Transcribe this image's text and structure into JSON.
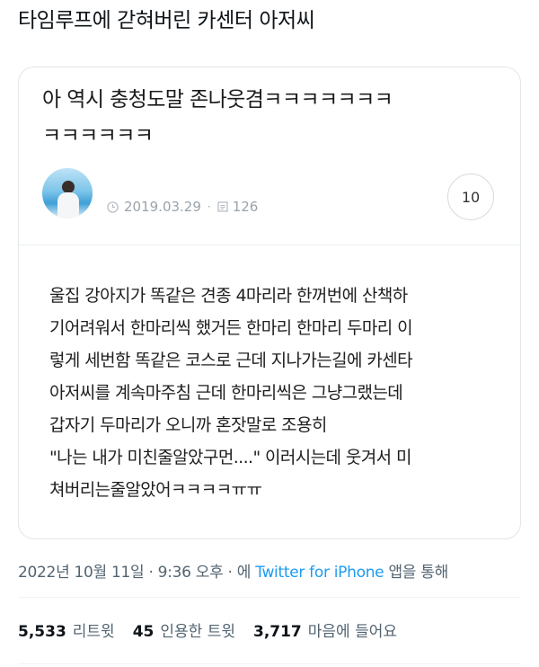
{
  "tweet": {
    "text": "타임루프에 갇혀버린 카센터 아저씨",
    "time": "2022년 10월 11일 · 9:36 오후 · 에 ",
    "source": "Twitter for iPhone",
    "source_suffix": " 앱을 통해"
  },
  "card": {
    "title_lines": [
      "아 역시 충청도말 존나웃겸ㅋㅋㅋㅋㅋㅋㅋ",
      "ㅋㅋㅋㅋㅋㅋ"
    ],
    "date": "2019.03.29",
    "views": "126",
    "comment_count": "10",
    "body_lines": [
      "울집 강아지가 똑같은 견종 4마리라 한꺼번에 산책하",
      "기어려워서 한마리씩 했거든 한마리 한마리 두마리 이",
      "렇게 세번함 똑같은 코스로 근데 지나가는길에 카센타",
      "아저씨를 계속마주침 근데 한마리씩은 그냥그랬는데",
      "갑자기 두마리가 오니까 혼잣말로 조용히",
      "\"나는 내가 미친줄알았구먼....\" 이러시는데 웃겨서 미",
      "쳐버리는줄알았어ㅋㅋㅋㅋㅠㅠ"
    ],
    "icons": {
      "date": "clock-icon",
      "views": "eye-icon",
      "avatar": "user-avatar"
    }
  },
  "stats": [
    {
      "num": "5,533",
      "label": "리트윗"
    },
    {
      "num": "45",
      "label": "인용한 트윗"
    },
    {
      "num": "3,717",
      "label": "마음에 들어요"
    }
  ],
  "colors": {
    "accent": "#1d9bf0",
    "muted": "#536471",
    "meta": "#9aa3ab",
    "border": "#e1e6ea"
  }
}
